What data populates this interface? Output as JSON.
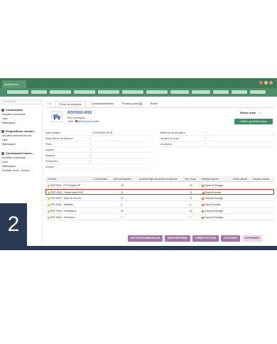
{
  "app": {
    "tab_label": "Application",
    "window_dots": [
      "#e27d60",
      "#f1c27b",
      "#f28b82"
    ]
  },
  "sidebar": {
    "search_placeholder": "Rechercher",
    "sections": [
      {
        "title": "Commandes",
        "links": [
          "Nouvelle commande",
          "Liste",
          "Statistiques"
        ]
      },
      {
        "title": "Propositions comme...",
        "links": [
          "Nouvelle demande de prix",
          "Liste",
          "Statistiques"
        ]
      },
      {
        "title": "Commandes fourni...",
        "links": [
          "Nouvelle commande",
          "Liste",
          "Statistiques",
          "Produits Livrés - Vendus"
        ]
      }
    ]
  },
  "tabs": [
    {
      "label": "Fiche de réception",
      "active": true
    },
    {
      "label": "Contacts/adresses",
      "active": false
    },
    {
      "label": "Fichiers joints",
      "count": "1",
      "active": false
    },
    {
      "label": "Notes",
      "active": false
    }
  ],
  "header": {
    "ref": "RCP2002-0002",
    "ref_supplier": "Réf. fournisseur :",
    "tiers": "Tiers : ",
    "tiers_name": "Bioffincht Anvoatis",
    "back_label": "Retour liste",
    "validate_label": "Valider (produits reçus)"
  },
  "fields_left": [
    {
      "label": "Date création",
      "value": "17/02/2020 10:49"
    },
    {
      "label": "Date prévue de livraison",
      "value": ""
    },
    {
      "label": "Poids",
      "value": ""
    },
    {
      "label": "Largeur",
      "value": ""
    },
    {
      "label": "Hauteur",
      "value": ""
    },
    {
      "label": "Profondeur",
      "value": ""
    },
    {
      "label": "Volume",
      "value": ""
    }
  ],
  "fields_right": [
    {
      "label": "Méthode de réception",
      "value": ""
    },
    {
      "label": "Numéro de suivi",
      "value": ""
    },
    {
      "label": "Incoterms",
      "value": ""
    }
  ],
  "table": {
    "headers": [
      "Produits",
      "Commentaire",
      "Qté commandée",
      "Quantité déjà des autres réceptions",
      "Qté. reçue",
      "Entrepôt source",
      "Poids calculé",
      "Volume calculé"
    ],
    "rows": [
      {
        "product": "REF-0001 - PC Portable HP",
        "ordered": "10",
        "received": "10",
        "warehouse": "Gourmet Storage",
        "highlight": false
      },
      {
        "product": "REF-0002 - Souris sans fil HP",
        "ordered": "8",
        "received": "8",
        "warehouse": "Dépôt Express",
        "highlight": true
      },
      {
        "product": "REF-0003 - Table de réunion",
        "ordered": "11",
        "received": "11",
        "warehouse": "Gourmet Storage",
        "highlight": false
      },
      {
        "product": "REF-0004 - Tablettes",
        "ordered": "4",
        "received": "4",
        "warehouse": "Dépôt Express",
        "highlight": false
      },
      {
        "product": "REF-0005 - Ordinateurs",
        "ordered": "12",
        "received": "12",
        "warehouse": "Gourmet Storage",
        "highlight": false
      },
      {
        "product": "REF-0006 - Téléviseur",
        "ordered": "7",
        "received": "7",
        "warehouse": "Gourmet Storage",
        "highlight": false
      }
    ]
  },
  "actions": [
    "RETOUR EN BROUILLON",
    "ENVOYER EMAIL",
    "CRÉER FACTURE",
    "CLÔTURER",
    "SUPPRIMER"
  ],
  "step_number": "2",
  "colors": {
    "brand_green": "#3d7a58",
    "action_purple": "#a876a5",
    "highlight_red": "#c0392b",
    "navy": "#2b3a54"
  }
}
